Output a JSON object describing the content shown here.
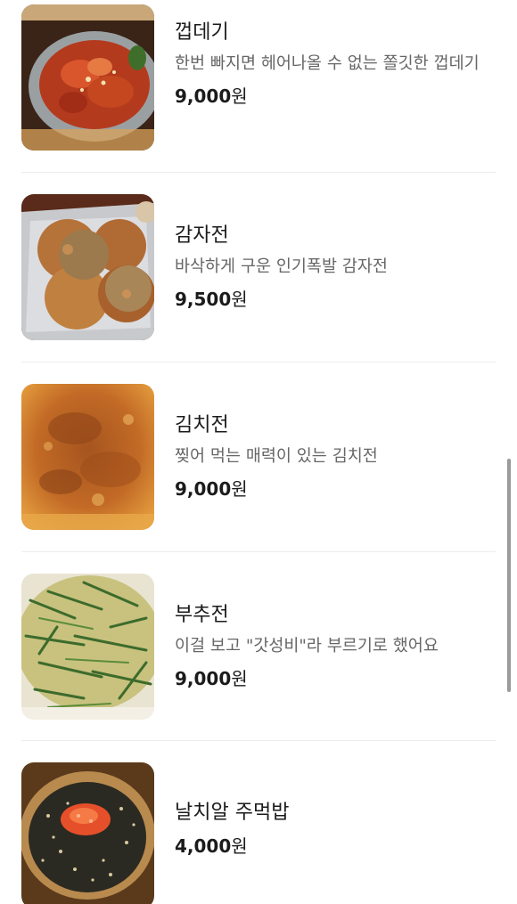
{
  "menu": {
    "currency_label": "원",
    "items": [
      {
        "name": "껍데기",
        "description": "한번 빠지면 헤어나올 수 없는 쫄깃한 껍데기",
        "price": "9,000",
        "image": "pork-skin-photo"
      },
      {
        "name": "감자전",
        "description": "바삭하게 구운 인기폭발 감자전",
        "price": "9,500",
        "image": "potato-pancake-photo"
      },
      {
        "name": "김치전",
        "description": "찢어 먹는 매력이 있는 김치전",
        "price": "9,000",
        "image": "kimchi-pancake-photo"
      },
      {
        "name": "부추전",
        "description": "이걸 보고 \"갓성비\"라 부르기로 했어요",
        "price": "9,000",
        "image": "chive-pancake-photo"
      },
      {
        "name": "날치알 주먹밥",
        "description": "",
        "price": "4,000",
        "image": "roe-rice-ball-photo"
      }
    ]
  }
}
